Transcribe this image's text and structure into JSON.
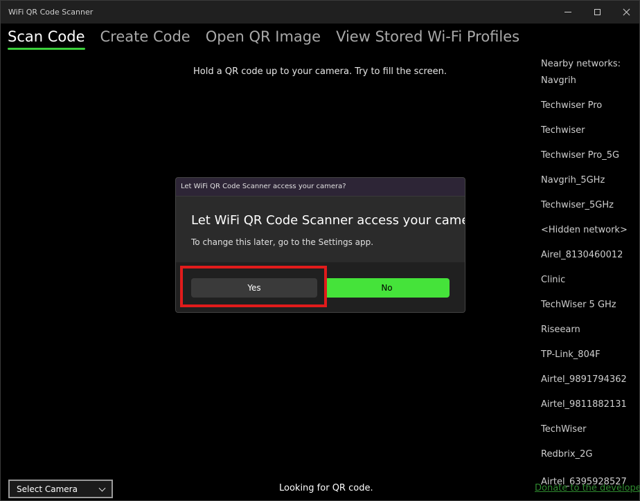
{
  "window": {
    "title": "WiFi QR Code Scanner",
    "controls": {
      "minimize": "minimize-icon",
      "maximize": "maximize-icon",
      "close": "close-icon"
    }
  },
  "tabs": [
    {
      "label": "Scan Code",
      "active": true
    },
    {
      "label": "Create Code",
      "active": false
    },
    {
      "label": "Open QR Image",
      "active": false
    },
    {
      "label": "View Stored Wi-Fi Profiles",
      "active": false
    }
  ],
  "scan": {
    "instruction": "Hold a QR code up to your camera. Try to fill the screen.",
    "status": "Looking for QR code.",
    "camera_select": "Select Camera"
  },
  "networks": {
    "header": "Nearby networks:",
    "items": [
      "Navgrih",
      "Techwiser Pro",
      "Techwiser",
      "Techwiser Pro_5G",
      "Navgrih_5GHz",
      "Techwiser_5GHz",
      "<Hidden network>",
      "Airel_8130460012",
      "Clinic",
      "TechWiser 5 GHz",
      "Riseearn",
      "TP-Link_804F",
      "Airtel_9891794362",
      "Airtel_9811882131",
      "TechWiser",
      "Redbrix_2G"
    ],
    "last_item": "Airtel_6395928527"
  },
  "dialog": {
    "title": "Let WiFi QR Code Scanner access your camera?",
    "heading": "Let WiFi QR Code Scanner access your camera?",
    "body": "To change this later, go to the Settings app.",
    "yes_label": "Yes",
    "no_label": "No"
  },
  "footer": {
    "donate_link": "Donate to the developer"
  },
  "colors": {
    "accent": "#3ccf3c",
    "no_button": "#45e33a",
    "highlight": "#e11b1b",
    "link": "#2f8a2f"
  }
}
